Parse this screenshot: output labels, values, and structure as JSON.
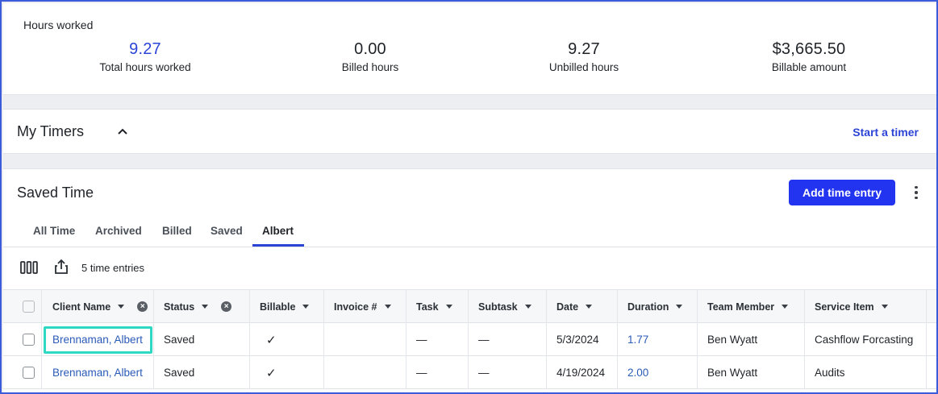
{
  "summary": {
    "title": "Hours worked",
    "stats": [
      {
        "value": "9.27",
        "label": "Total hours worked",
        "accent": true
      },
      {
        "value": "0.00",
        "label": "Billed hours",
        "accent": false
      },
      {
        "value": "9.27",
        "label": "Unbilled hours",
        "accent": false
      },
      {
        "value": "$3,665.50",
        "label": "Billable amount",
        "accent": false
      }
    ]
  },
  "timers": {
    "title": "My Timers",
    "start_label": "Start a timer"
  },
  "saved": {
    "title": "Saved Time",
    "add_label": "Add time entry",
    "tabs": [
      "All Time",
      "Archived",
      "Billed",
      "Saved",
      "Albert"
    ],
    "active_tab": "Albert",
    "entries_count": "5 time entries"
  },
  "table": {
    "columns": [
      "Client Name",
      "Status",
      "Billable",
      "Invoice #",
      "Task",
      "Subtask",
      "Date",
      "Duration",
      "Team Member",
      "Service Item"
    ],
    "rows": [
      {
        "client": "Brennaman, Albert",
        "status": "Saved",
        "billable": "✓",
        "invoice": "",
        "task": "—",
        "subtask": "—",
        "date": "5/3/2024",
        "duration": "1.77",
        "member": "Ben Wyatt",
        "service": "Cashflow Forcasting"
      },
      {
        "client": "Brennaman, Albert",
        "status": "Saved",
        "billable": "✓",
        "invoice": "",
        "task": "—",
        "subtask": "—",
        "date": "4/19/2024",
        "duration": "2.00",
        "member": "Ben Wyatt",
        "service": "Audits"
      }
    ]
  },
  "colors": {
    "accent": "#2b44d6",
    "button": "#2234f0",
    "highlight": "#2ed8c3",
    "link": "#2b5bb8"
  }
}
